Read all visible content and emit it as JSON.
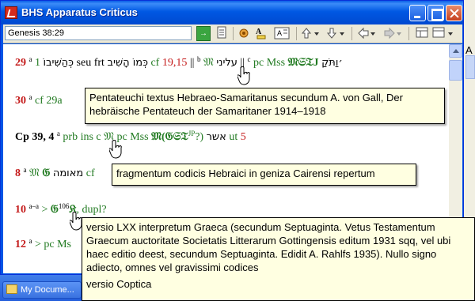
{
  "window": {
    "title": "BHS Apparatus Criticus"
  },
  "toolbar": {
    "reference_value": "Genesis 38:29",
    "go_label": "→"
  },
  "desktop": {
    "partial_letter": "A"
  },
  "taskbar": {
    "task_label": "My Docume..."
  },
  "lines": [
    {
      "ref": "29",
      "parts": [
        "a",
        "1",
        "כְּהַשִּׁיבוֹ",
        "seu frt",
        "כְּמוֹ הָשִׁיב",
        "cf",
        "19,15",
        "||",
        "b",
        "𝔐",
        "עליני",
        "||",
        "c",
        "pc Mss",
        "𝔐𝔖𝔗J",
        "׳וַתֹּקַ"
      ]
    },
    {
      "ref": "30",
      "parts": [
        "a",
        "cf 29a"
      ]
    },
    {
      "ref": "Cp 39, 4",
      "parts": [
        "a",
        "prb ins c",
        "𝔐",
        "pc Mss",
        "𝔐(𝔊𝔖𝔗",
        "JP",
        "?)",
        "אשר",
        "ut",
        "5"
      ]
    },
    {
      "ref": "8",
      "parts": [
        "a",
        "𝔐",
        "𝔊",
        "מאומה",
        "cf"
      ]
    },
    {
      "ref": "10",
      "parts": [
        "a–a",
        ">",
        "𝔊",
        "106",
        "𝔎",
        ", dupl?"
      ]
    },
    {
      "ref": "12",
      "parts": [
        "a",
        "> pc Ms"
      ]
    }
  ],
  "tooltips": {
    "samaritan": "Pentateuchi textus Hebraeo-Samaritanus secundum A. von Gall, Der hebräische Pentateuch der Samaritaner 1914–1918",
    "geniza": "fragmentum codicis Hebraici in geniza Cairensi repertum",
    "septuagint": "versio LXX interpretum Graeca (secundum Septuaginta. Vetus Testamentum Graecum auctoritate Societatis Litterarum Gottingensis editum 1931 sqq, vel ubi haec editio deest, secundum Septuaginta. Edidit A. Rahlfs 1935). Nullo signo adiecto, omnes vel gravissimi codices",
    "coptic": "versio Coptica"
  }
}
